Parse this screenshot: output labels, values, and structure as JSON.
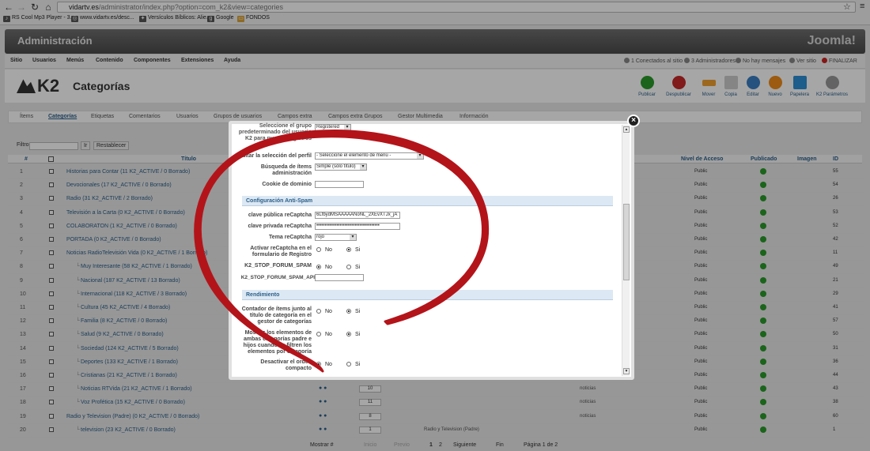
{
  "browser": {
    "url_host": "vidartv.es",
    "url_path": "/administrator/index.php?option=com_k2&view=categories",
    "bookmarks": [
      "RS Cool Mp3 Player - 3...",
      "www.vidartv.es/desc...",
      "Versículos Bíblicos: Alie...",
      "Google",
      "FONDOS"
    ]
  },
  "admin": {
    "title": "Administración",
    "brand": "Joomla!",
    "menu": [
      "Sitio",
      "Usuarios",
      "Menús",
      "Contenido",
      "Componentes",
      "Extensiones",
      "Ayuda"
    ],
    "status": [
      "1 Conectados al sitio",
      "3 Administradores",
      "No hay mensajes",
      "Ver sitio",
      "FINALIZAR"
    ]
  },
  "k2": {
    "logo": "K2",
    "page_title": "Categorías",
    "toolbar": [
      "Publicar",
      "Despublicar",
      "Mover",
      "Copia",
      "Editar",
      "Nuevo",
      "Papelera",
      "K2 Parámetros"
    ],
    "tabs": [
      "Ítems",
      "Categorías",
      "Etiquetas",
      "Comentarios",
      "Usuarios",
      "Grupos de usuarios",
      "Campos extra",
      "Campos extra Grupos",
      "Gestor Multimedia",
      "Información"
    ]
  },
  "filter": {
    "label": "Filtro",
    "go": "Ir",
    "reset": "Restablecer"
  },
  "table": {
    "headers": {
      "num": "#",
      "title": "Título",
      "access": "Nivel de Acceso",
      "published": "Publicado",
      "image": "Imagen",
      "id": "ID"
    },
    "access_value": "Public",
    "rows": [
      {
        "n": "1",
        "title": "Historias para Contar (11 K2_ACTIVE / 0 Borrado)",
        "id": "55"
      },
      {
        "n": "2",
        "title": "Devocionales (17 K2_ACTIVE / 0 Borrado)",
        "id": "54"
      },
      {
        "n": "3",
        "title": "Radio (31 K2_ACTIVE / 2 Borrado)",
        "id": "26"
      },
      {
        "n": "4",
        "title": "Televisión a la Carta (0 K2_ACTIVE / 0 Borrado)",
        "id": "53"
      },
      {
        "n": "5",
        "title": "COLABORATON (1 K2_ACTIVE / 0 Borrado)",
        "id": "52"
      },
      {
        "n": "6",
        "title": "PORTADA (0 K2_ACTIVE / 0 Borrado)",
        "id": "42"
      },
      {
        "n": "7",
        "title": "Noticias RadioTelevisión Vida (0 K2_ACTIVE / 1 Borrado)",
        "id": "11"
      },
      {
        "n": "8",
        "title": "Muy Interesante (58 K2_ACTIVE / 1 Borrado)",
        "id": "49"
      },
      {
        "n": "9",
        "title": "Nacional (187 K2_ACTIVE / 13 Borrado)",
        "id": "21"
      },
      {
        "n": "10",
        "title": "Internacional (118 K2_ACTIVE / 3 Borrado)",
        "id": "29"
      },
      {
        "n": "11",
        "title": "Cultura (45 K2_ACTIVE / 4 Borrado)",
        "id": "41"
      },
      {
        "n": "12",
        "title": "Familia (8 K2_ACTIVE / 0 Borrado)",
        "id": "57"
      },
      {
        "n": "13",
        "title": "Salud (9 K2_ACTIVE / 0 Borrado)",
        "id": "50"
      },
      {
        "n": "14",
        "title": "Sociedad (124 K2_ACTIVE / 5 Borrado)",
        "id": "31"
      },
      {
        "n": "15",
        "title": "Deportes (133 K2_ACTIVE / 1 Borrado)",
        "id": "36"
      },
      {
        "n": "16",
        "title": "Cristianas (21 K2_ACTIVE / 1 Borrado)",
        "id": "44"
      },
      {
        "n": "17",
        "title": "Noticias RTVida (21 K2_ACTIVE / 1 Borrado)",
        "id": "43",
        "order": "10",
        "extra": "noticias"
      },
      {
        "n": "18",
        "title": "Voz Profética (15 K2_ACTIVE / 0 Borrado)",
        "id": "38",
        "order": "11",
        "extra": "noticias"
      },
      {
        "n": "19",
        "title": "Radio y Television (Padre) (0 K2_ACTIVE / 0 Borrado)",
        "id": "60",
        "order": "8",
        "extra": "noticias"
      },
      {
        "n": "20",
        "title": "television (23 K2_ACTIVE / 0 Borrado)",
        "id": "1",
        "order": "1",
        "extra": "Radio y Television (Padre)"
      }
    ]
  },
  "pager": {
    "show": "Mostrar #",
    "start": "Inicio",
    "prev": "Previo",
    "p1": "1",
    "p2": "2",
    "next": "Siguiente",
    "end": "Fin",
    "page": "Página 1 de 2"
  },
  "modal": {
    "top_field_label": "Seleccione el grupo predeterminado del usuario K2 para nuevos registros",
    "top_field_value": "Registered",
    "profile_label": "Editar la selección del perfil",
    "profile_value": "- Seleccione el elemento de menú -",
    "search_label": "Búsqueda de ítems administración",
    "search_value": "Simple (sólo título)",
    "cookie_label": "Cookie de dominio",
    "cookie_value": "",
    "antispam_header": "Configuración Anti-Spam",
    "pubkey_label": "clave pública reCaptcha",
    "pubkey_value": "6LfbydMSAAAAANoNL_2XEvXTJx_jA",
    "privkey_label": "clave privada reCaptcha",
    "privkey_value": "••••••••••••••••••••••••••••••••••••••",
    "theme_label": "Tema reCaptcha",
    "theme_value": "rojo",
    "activate_label": "Activar reCaptcha en el formulario de Registro",
    "stopspam_label": "K2_STOP_FORUM_SPAM",
    "stopspam_api_label": "K2_STOP_FORUM_SPAM_API",
    "stopspam_api_value": "",
    "perf_header": "Rendimiento",
    "count_label": "Contador de ítems junto al título de categoría en el gestor de categorías",
    "showboth_label": "Mostrar los elementos de ambas categorías padre e hijos cuando se filtren los elementos por categoría",
    "compact_label": "Desactivar el orden compacto",
    "no": "No",
    "si": "Si"
  },
  "colors": {
    "annotation_circle": "#b3141a",
    "link": "#2c5f8a",
    "published_ok": "#2a9a2a"
  }
}
